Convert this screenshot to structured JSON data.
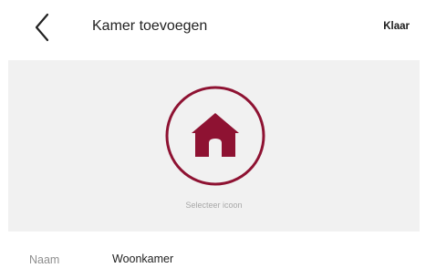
{
  "header": {
    "back_icon": "chevron-left-icon",
    "title": "Kamer toevoegen",
    "done_label": "Klaar"
  },
  "icon_panel": {
    "icon": "house-icon",
    "caption": "Selecteer icoon",
    "accent_color": "#8e1232",
    "background_color": "#f1f1f1"
  },
  "name_field": {
    "label": "Naam",
    "value": "Woonkamer"
  }
}
